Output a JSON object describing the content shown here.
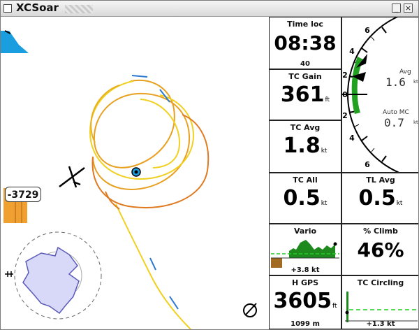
{
  "window": {
    "title": "XCSoar",
    "min_glyph": "_",
    "close_glyph": "×"
  },
  "map": {
    "altitude_flag": "-3729"
  },
  "infoboxes": {
    "time_local": {
      "title": "Time loc",
      "value": "08:38",
      "comment": "40"
    },
    "tc_gain": {
      "title": "TC Gain",
      "value": "361",
      "unit": "ft"
    },
    "tc_avg": {
      "title": "TC Avg",
      "value": "1.8",
      "unit": "kt"
    },
    "tc_all": {
      "title": "TC All",
      "value": "0.5",
      "unit": "kt"
    },
    "tl_avg": {
      "title": "TL Avg",
      "value": "0.5",
      "unit": "kt"
    },
    "vario_trace": {
      "title": "Vario",
      "comment": "+3.8 kt"
    },
    "percent_climb": {
      "title": "% Climb",
      "value": "46%"
    },
    "h_gps": {
      "title": "H GPS",
      "value": "3605",
      "unit": "ft",
      "comment": "1099 m"
    },
    "tc_circling": {
      "title": "TC Circling",
      "comment": "+1.3 kt"
    }
  },
  "vario_gauge": {
    "avg_label": "Avg",
    "avg_value": "1.6",
    "avg_unit": "kt",
    "auto_mc_label": "Auto MC",
    "auto_mc_value": "0.7",
    "auto_mc_unit": "kt",
    "scale_labels": [
      "6",
      "4",
      "2",
      "0",
      "2",
      "4",
      "6"
    ],
    "colors": {
      "lift_arc": "#22a022",
      "pointer": "#000000"
    }
  },
  "colors": {
    "trail_warm": "#e8a020",
    "trail_yellow": "#f0d020",
    "trail_blue": "#2a78d0",
    "airspace_blue": "#1a9ee0",
    "barogram_orange": "#f0a030",
    "wind_fill": "#d8d8f8",
    "trace_green": "#1e8a1e",
    "trace_brown": "#a06a20"
  }
}
